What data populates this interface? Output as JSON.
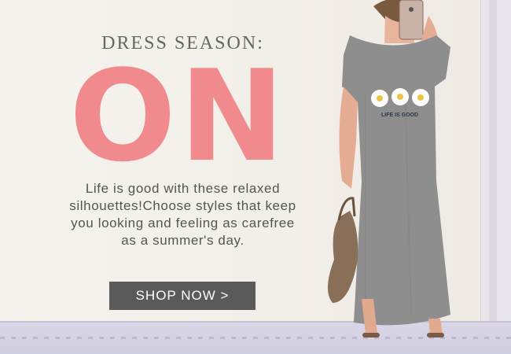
{
  "banner": {
    "headline": "DRESS SEASON:",
    "big_word": "ON",
    "body": "Life is good with these relaxed silhouettes!Choose styles that keep you looking and feeling as carefree as a summer's day.",
    "cta_label": "SHOP NOW >",
    "dress_print_text": "LIFE IS GOOD"
  },
  "colors": {
    "accent_pink": "#f08a8d",
    "button_bg": "#5a5a5a",
    "text_gray": "#555555",
    "dress_gray": "#8e8e8e"
  }
}
